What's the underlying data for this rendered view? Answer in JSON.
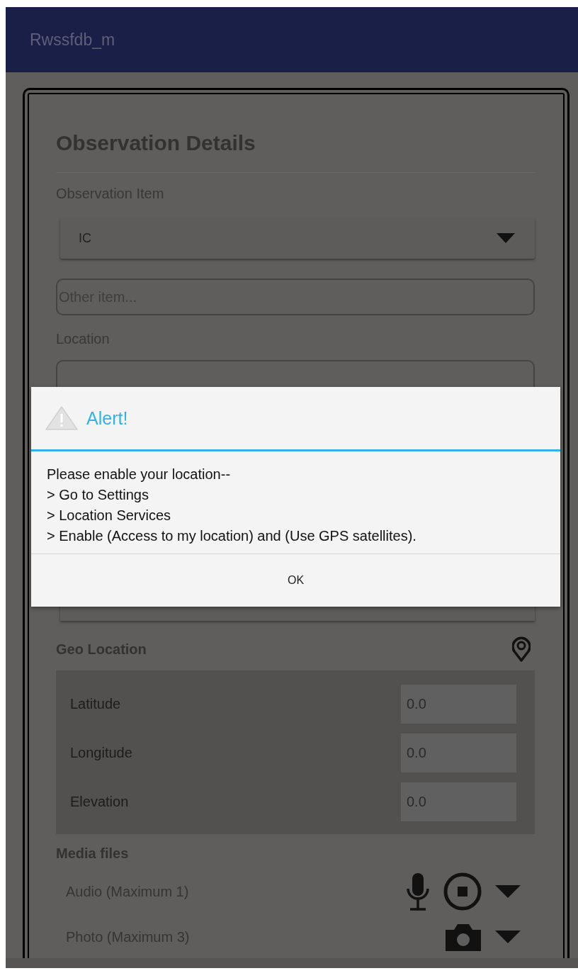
{
  "app_bar": {
    "title": "Rwssfdb_m"
  },
  "form": {
    "title": "Observation Details",
    "observation_item": {
      "label": "Observation Item",
      "value": "IC"
    },
    "other_item": {
      "placeholder": "Other item..."
    },
    "location": {
      "label": "Location"
    },
    "geo_location": {
      "label": "Geo Location",
      "fields": [
        {
          "label": "Latitude",
          "placeholder": "0.0"
        },
        {
          "label": "Longitude",
          "placeholder": "0.0"
        },
        {
          "label": "Elevation",
          "placeholder": "0.0"
        }
      ]
    },
    "media_files": {
      "label": "Media files",
      "items": [
        {
          "kind": "audio",
          "label": "Audio (Maximum 1)"
        },
        {
          "kind": "photo",
          "label": "Photo (Maximum 3)"
        }
      ]
    }
  },
  "dialog": {
    "title": "Alert!",
    "message": "Please enable your location--\n> Go to Settings\n> Location Services\n> Enable (Access to my location) and (Use GPS satellites).",
    "button": "OK"
  }
}
